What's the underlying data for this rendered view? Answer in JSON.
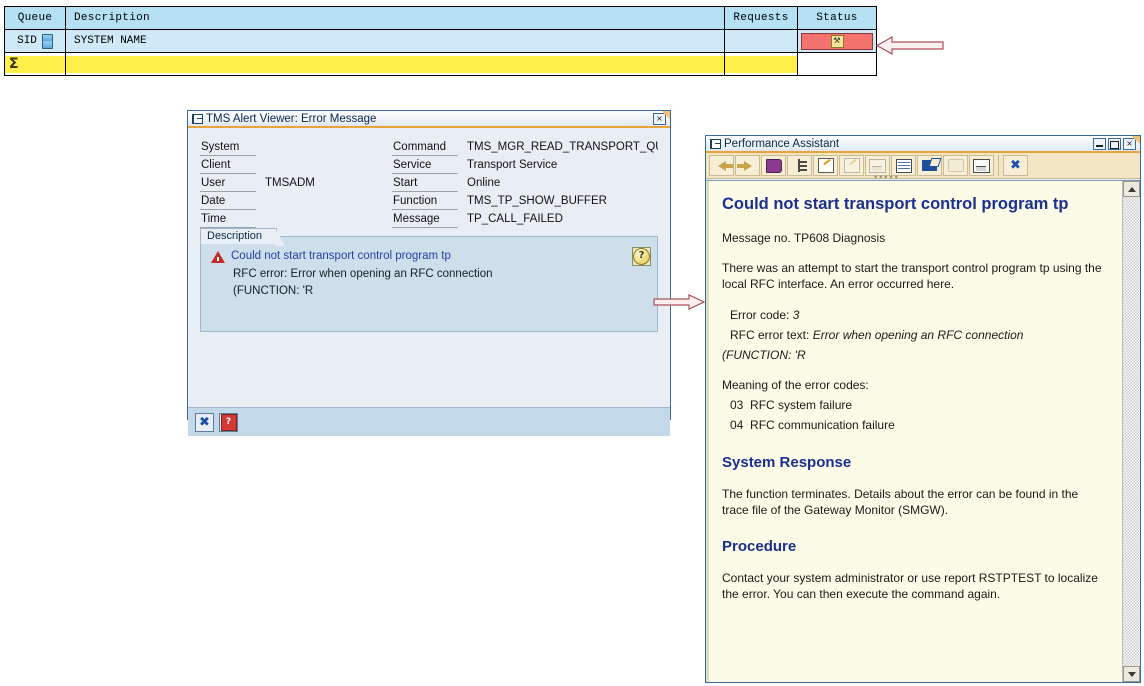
{
  "queue_table": {
    "headers": [
      "Queue",
      "Description",
      "Requests",
      "Status"
    ],
    "row": {
      "queue": "SID",
      "description": "SYSTEM NAME",
      "requests": "",
      "status": ""
    },
    "status_color": "#f4736e"
  },
  "tms_dialog": {
    "title": "TMS Alert Viewer: Error Message",
    "close_label": "×",
    "fields_left": [
      {
        "label": "System",
        "value": ""
      },
      {
        "label": "Client",
        "value": ""
      },
      {
        "label": "User",
        "value": "TMSADM"
      },
      {
        "label": "Date",
        "value": ""
      },
      {
        "label": "Time",
        "value": ""
      }
    ],
    "fields_right": [
      {
        "label": "Command",
        "value": "TMS_MGR_READ_TRANSPORT_QUE..."
      },
      {
        "label": "Service",
        "value": "Transport Service"
      },
      {
        "label": "Start",
        "value": "Online"
      },
      {
        "label": "Function",
        "value": "TMS_TP_SHOW_BUFFER"
      },
      {
        "label": "Message",
        "value": "TP_CALL_FAILED"
      }
    ],
    "description": {
      "tab_label": "Description",
      "headline": "Could not start transport control program tp",
      "line2": "RFC error: Error when opening an RFC connection",
      "line3": "(FUNCTION: 'R",
      "help_glyph": "?"
    },
    "footer": {
      "cancel_glyph": "✖",
      "help_glyph": "?"
    }
  },
  "performance_assistant": {
    "title": "Performance Assistant",
    "window_buttons": {
      "minimize": "_",
      "maximize": "□",
      "close": "×"
    },
    "toolbar": [
      {
        "name": "back-icon",
        "enabled": true
      },
      {
        "name": "forward-icon",
        "enabled": true
      },
      {
        "name": "glossary-book-icon",
        "enabled": true
      },
      {
        "name": "application-help-tree-icon",
        "enabled": true
      },
      {
        "name": "note-edit-icon",
        "enabled": true
      },
      {
        "name": "technical-info-icon",
        "enabled": false
      },
      {
        "name": "customizing-icon",
        "enabled": false
      },
      {
        "name": "table-view-icon",
        "enabled": true
      },
      {
        "name": "create-note-icon",
        "enabled": true
      },
      {
        "name": "display-screen-icon",
        "enabled": false
      },
      {
        "name": "print-icon",
        "enabled": true
      },
      {
        "name": "close-assistant-icon",
        "enabled": true
      }
    ],
    "content": {
      "heading": "Could not start transport control program tp",
      "message_no": "Message no. TP608 Diagnosis",
      "diagnosis": "There was an attempt to start the transport control program tp using the local RFC interface. An error occurred here.",
      "error_code_label": "Error code:",
      "error_code_value": "3",
      "rfc_error_label": "RFC error text:",
      "rfc_error_value": "Error when opening an RFC connection",
      "rfc_error_cont": "(FUNCTION: 'R",
      "codes_intro": "Meaning of the error codes:",
      "codes": [
        {
          "code": "03",
          "text": "RFC system failure"
        },
        {
          "code": "04",
          "text": "RFC communication failure"
        }
      ],
      "system_response_heading": "System Response",
      "system_response_text": "The function terminates. Details about the error can be found in the trace file of the Gateway Monitor (SMGW).",
      "procedure_heading": "Procedure",
      "procedure_text": "Contact your system administrator or use report RSTPTEST to localize the error. You can then execute the command again."
    }
  },
  "annotations": {
    "arrow_to_status": "arrow pointing left at status badge",
    "arrow_to_assistant": "arrow pointing right from help button"
  }
}
